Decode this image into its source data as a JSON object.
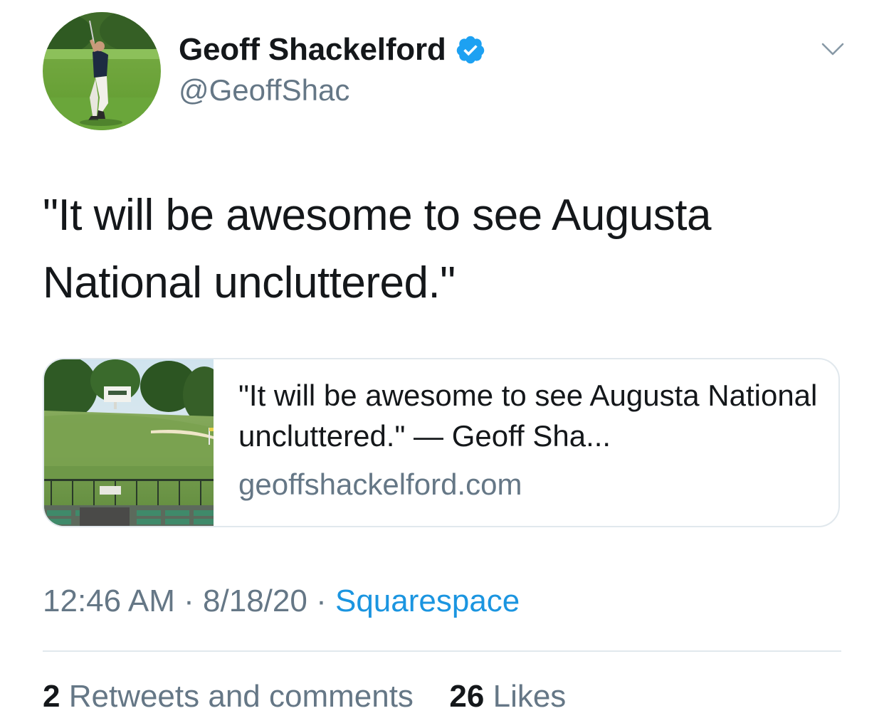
{
  "author": {
    "display_name": "Geoff Shackelford",
    "handle": "@GeoffShac",
    "verified": true,
    "verified_color": "#1da1f2"
  },
  "tweet": {
    "text": "\"It will be awesome to see Augusta National uncluttered.\""
  },
  "link_card": {
    "title": "\"It will be awesome to see Augusta National uncluttered.\" — Geoff Sha...",
    "domain": "geoffshackelford.com"
  },
  "meta": {
    "time": "12:46 AM",
    "separator": "·",
    "date": "8/18/20",
    "source": "Squarespace"
  },
  "stats": {
    "retweets_count": "2",
    "retweets_label": "Retweets and comments",
    "likes_count": "26",
    "likes_label": "Likes"
  },
  "colors": {
    "text_primary": "#14171a",
    "text_secondary": "#657786",
    "link": "#1b95e0",
    "border": "#e1e8ed"
  }
}
